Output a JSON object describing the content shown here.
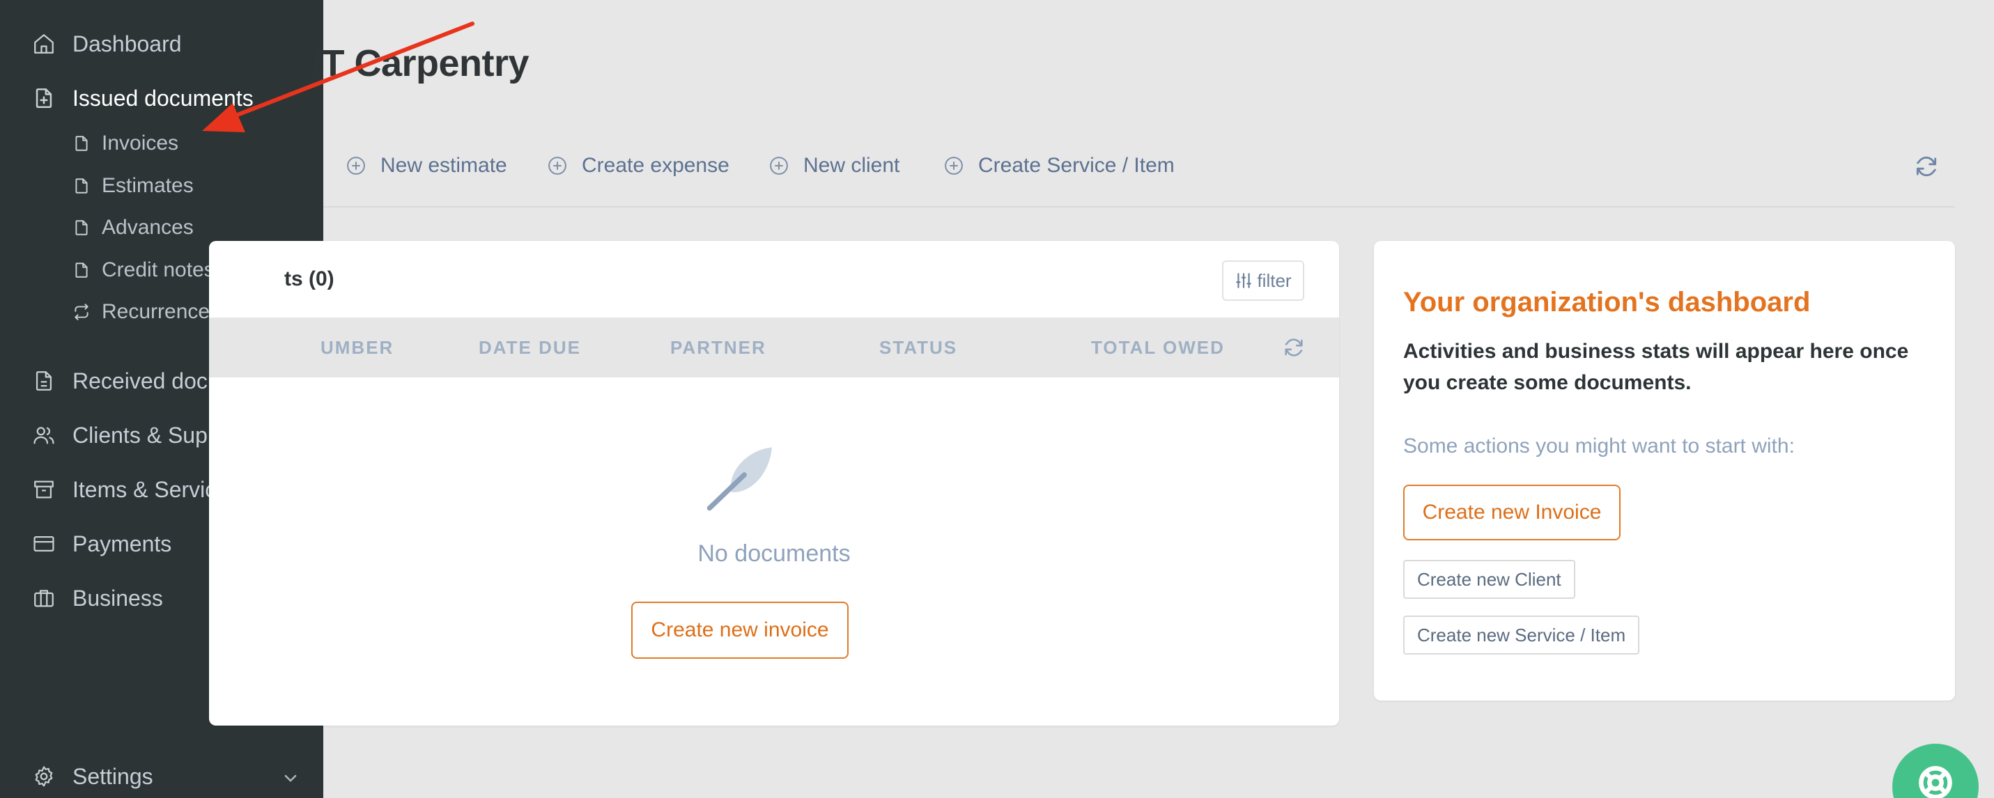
{
  "sidebar": {
    "items": [
      {
        "label": "Dashboard",
        "icon": "home-icon"
      },
      {
        "label": "Issued documents",
        "icon": "file-plus-icon"
      },
      {
        "label": "Received documents",
        "icon": "file-text-icon"
      },
      {
        "label": "Clients & Suppliers",
        "icon": "users-icon"
      },
      {
        "label": "Items & Services",
        "icon": "archive-icon"
      },
      {
        "label": "Payments",
        "icon": "credit-card-icon"
      },
      {
        "label": "Business",
        "icon": "briefcase-icon"
      },
      {
        "label": "Settings",
        "icon": "gear-icon"
      }
    ],
    "sub_items": [
      {
        "label": "Invoices",
        "icon": "file-icon"
      },
      {
        "label": "Estimates",
        "icon": "file-icon"
      },
      {
        "label": "Advances",
        "icon": "file-icon"
      },
      {
        "label": "Credit notes",
        "icon": "file-icon"
      },
      {
        "label": "Recurrences",
        "icon": "repeat-icon"
      }
    ]
  },
  "header": {
    "title": "/T Carpentry"
  },
  "actions": [
    {
      "label": "New estimate",
      "icon": "plus-circle-icon"
    },
    {
      "label": "Create expense",
      "icon": "plus-circle-icon"
    },
    {
      "label": "New client",
      "icon": "plus-circle-icon"
    },
    {
      "label": "Create Service / Item",
      "icon": "plus-circle-icon"
    }
  ],
  "documents": {
    "title": "ts (0)",
    "filter_label": "filter",
    "columns": [
      "UMBER",
      "DATE DUE",
      "PARTNER",
      "STATUS",
      "TOTAL OWED"
    ],
    "empty_text": "No documents",
    "create_button": "Create new invoice"
  },
  "dashboard": {
    "title": "Your organization's dashboard",
    "description": "Activities and business stats will appear here once you create some documents.",
    "subtitle": "Some actions you might want to start with:",
    "primary_button": "Create new Invoice",
    "secondary_buttons": [
      "Create new Client",
      "Create new Service / Item"
    ]
  },
  "colors": {
    "sidebar_bg": "#2c3436",
    "accent_orange": "#e4731f",
    "help_green": "#45c28a",
    "annotation_red": "#e8341c"
  }
}
